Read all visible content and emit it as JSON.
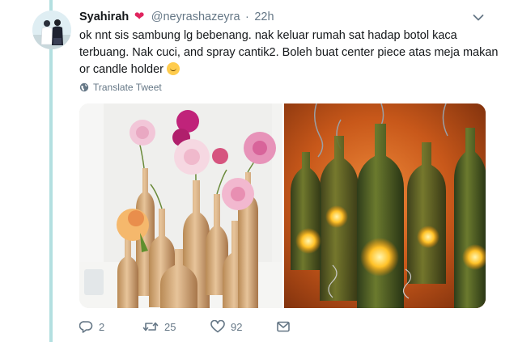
{
  "tweet": {
    "display_name": "Syahirah",
    "verified_emoji": "heart-icon",
    "handle": "@neyrashazeyra",
    "separator": "·",
    "timestamp": "22h",
    "text_lines": [
      "ok nnt sis sambung lg bebenang. nak keluar rumah sat hadap botol kaca",
      "terbuang. Nak cuci, and spray cantik2. Boleh buat center piece atas meja makan",
      "or candle holder"
    ],
    "text_emoji": "face-with-hand-over-mouth-emoji",
    "translate_label": "Translate Tweet"
  },
  "media": {
    "photos": [
      {
        "name": "gold-painted-bottles-with-flowers"
      },
      {
        "name": "green-bottle-candle-holders"
      }
    ]
  },
  "actions": {
    "reply_count": "2",
    "retweet_count": "25",
    "like_count": "92"
  },
  "colors": {
    "thread_line": "#b3dfe0",
    "text": "#14171a",
    "muted": "#657786",
    "heart": "#e0245e"
  }
}
